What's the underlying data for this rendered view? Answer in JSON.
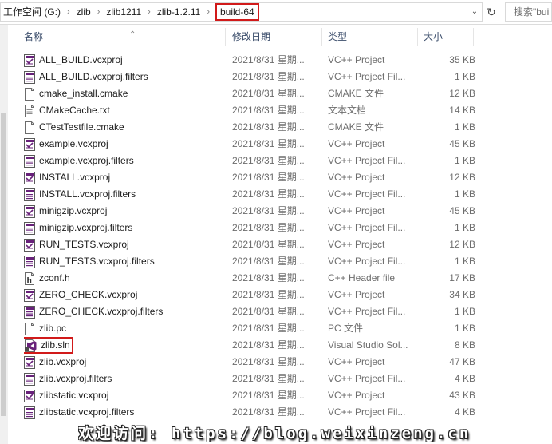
{
  "address_bar": {
    "crumbs": [
      "工作空间 (G:)",
      "zlib",
      "zlib1211",
      "zlib-1.2.11"
    ],
    "current": "build-64",
    "separator": "›",
    "search_placeholder": "搜索\"bui"
  },
  "columns": {
    "name": "名称",
    "date": "修改日期",
    "type": "类型",
    "size": "大小"
  },
  "files": [
    {
      "name": "ALL_BUILD.vcxproj",
      "date": "2021/8/31 星期...",
      "type": "VC++ Project",
      "size": "35 KB",
      "icon": "vcxproj-icon"
    },
    {
      "name": "ALL_BUILD.vcxproj.filters",
      "date": "2021/8/31 星期...",
      "type": "VC++ Project Fil...",
      "size": "1 KB",
      "icon": "filters-icon"
    },
    {
      "name": "cmake_install.cmake",
      "date": "2021/8/31 星期...",
      "type": "CMAKE 文件",
      "size": "12 KB",
      "icon": "blank-file-icon"
    },
    {
      "name": "CMakeCache.txt",
      "date": "2021/8/31 星期...",
      "type": "文本文档",
      "size": "14 KB",
      "icon": "text-file-icon"
    },
    {
      "name": "CTestTestfile.cmake",
      "date": "2021/8/31 星期...",
      "type": "CMAKE 文件",
      "size": "1 KB",
      "icon": "blank-file-icon"
    },
    {
      "name": "example.vcxproj",
      "date": "2021/8/31 星期...",
      "type": "VC++ Project",
      "size": "45 KB",
      "icon": "vcxproj-icon"
    },
    {
      "name": "example.vcxproj.filters",
      "date": "2021/8/31 星期...",
      "type": "VC++ Project Fil...",
      "size": "1 KB",
      "icon": "filters-icon"
    },
    {
      "name": "INSTALL.vcxproj",
      "date": "2021/8/31 星期...",
      "type": "VC++ Project",
      "size": "12 KB",
      "icon": "vcxproj-icon"
    },
    {
      "name": "INSTALL.vcxproj.filters",
      "date": "2021/8/31 星期...",
      "type": "VC++ Project Fil...",
      "size": "1 KB",
      "icon": "filters-icon"
    },
    {
      "name": "minigzip.vcxproj",
      "date": "2021/8/31 星期...",
      "type": "VC++ Project",
      "size": "45 KB",
      "icon": "vcxproj-icon"
    },
    {
      "name": "minigzip.vcxproj.filters",
      "date": "2021/8/31 星期...",
      "type": "VC++ Project Fil...",
      "size": "1 KB",
      "icon": "filters-icon"
    },
    {
      "name": "RUN_TESTS.vcxproj",
      "date": "2021/8/31 星期...",
      "type": "VC++ Project",
      "size": "12 KB",
      "icon": "vcxproj-icon"
    },
    {
      "name": "RUN_TESTS.vcxproj.filters",
      "date": "2021/8/31 星期...",
      "type": "VC++ Project Fil...",
      "size": "1 KB",
      "icon": "filters-icon"
    },
    {
      "name": "zconf.h",
      "date": "2021/8/31 星期...",
      "type": "C++ Header file",
      "size": "17 KB",
      "icon": "header-file-icon"
    },
    {
      "name": "ZERO_CHECK.vcxproj",
      "date": "2021/8/31 星期...",
      "type": "VC++ Project",
      "size": "34 KB",
      "icon": "vcxproj-icon"
    },
    {
      "name": "ZERO_CHECK.vcxproj.filters",
      "date": "2021/8/31 星期...",
      "type": "VC++ Project Fil...",
      "size": "1 KB",
      "icon": "filters-icon"
    },
    {
      "name": "zlib.pc",
      "date": "2021/8/31 星期...",
      "type": "PC 文件",
      "size": "1 KB",
      "icon": "blank-file-icon"
    },
    {
      "name": "zlib.sln",
      "date": "2021/8/31 星期...",
      "type": "Visual Studio Sol...",
      "size": "8 KB",
      "icon": "solution-file-icon",
      "highlighted": true
    },
    {
      "name": "zlib.vcxproj",
      "date": "2021/8/31 星期...",
      "type": "VC++ Project",
      "size": "47 KB",
      "icon": "vcxproj-icon"
    },
    {
      "name": "zlib.vcxproj.filters",
      "date": "2021/8/31 星期...",
      "type": "VC++ Project Fil...",
      "size": "4 KB",
      "icon": "filters-icon"
    },
    {
      "name": "zlibstatic.vcxproj",
      "date": "2021/8/31 星期...",
      "type": "VC++ Project",
      "size": "43 KB",
      "icon": "vcxproj-icon"
    },
    {
      "name": "zlibstatic.vcxproj.filters",
      "date": "2021/8/31 星期...",
      "type": "VC++ Project Fil...",
      "size": "4 KB",
      "icon": "filters-icon"
    }
  ],
  "watermark": "欢迎访问: https://blog.weixinzeng.cn",
  "colors": {
    "highlight": "#d11a1a",
    "header_text": "#3b4d6b",
    "vs_purple": "#68217a"
  }
}
